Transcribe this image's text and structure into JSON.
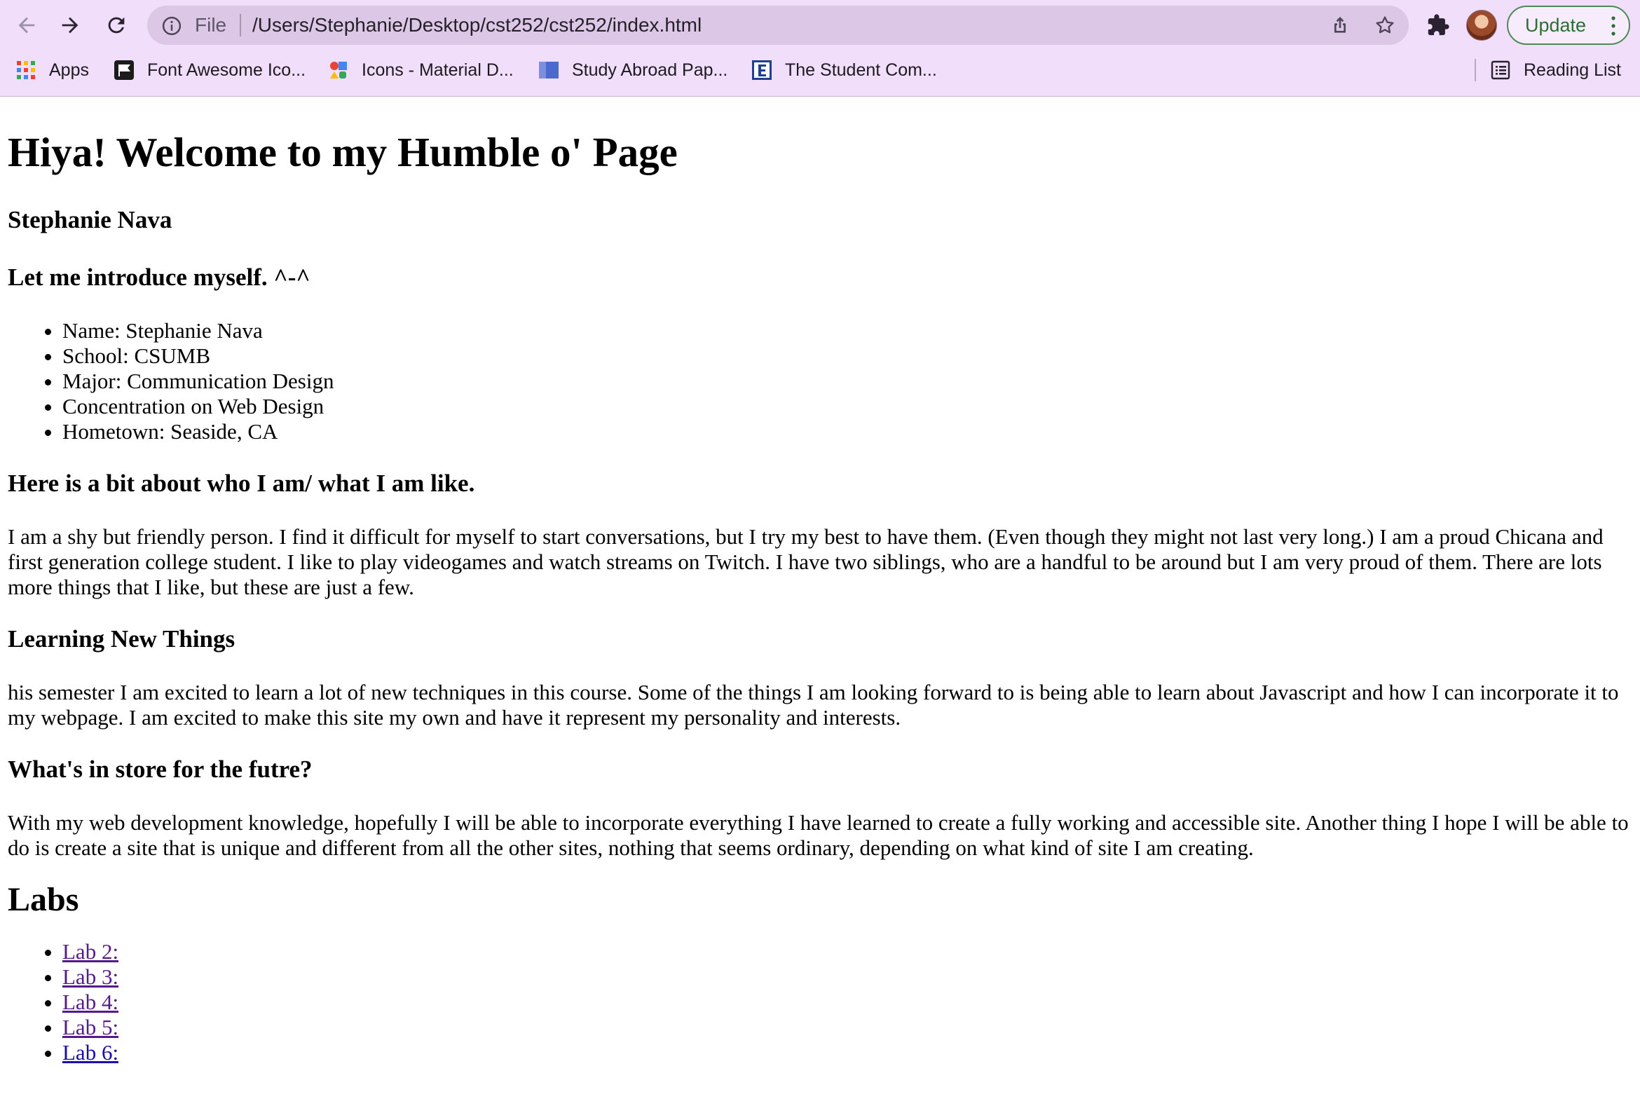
{
  "browser": {
    "scheme_label": "File",
    "url": "/Users/Stephanie/Desktop/cst252/cst252/index.html",
    "update_label": "Update",
    "icons": [
      "back-icon",
      "forward-icon",
      "reload-icon",
      "info-icon",
      "share-icon",
      "star-icon",
      "puzzle-icon",
      "kebab-icon"
    ],
    "accent": "#2c6e36",
    "theme_background": "#f0defa"
  },
  "bookmarks": {
    "items": [
      {
        "label": "Apps"
      },
      {
        "label": "Font Awesome Ico..."
      },
      {
        "label": "Icons - Material D..."
      },
      {
        "label": "Study Abroad Pap..."
      },
      {
        "label": "The Student Com..."
      }
    ],
    "reading_list": "Reading List"
  },
  "page": {
    "title": "Hiya! Welcome to my Humble o' Page",
    "author": "Stephanie Nava",
    "intro_heading": "Let me introduce myself. ^-^",
    "intro_items": [
      "Name: Stephanie Nava",
      "School: CSUMB",
      "Major: Communication Design",
      "Concentration on Web Design",
      "Hometown: Seaside, CA"
    ],
    "about_heading": "Here is a bit about who I am/ what I am like.",
    "about_text": "I am a shy but friendly person. I find it difficult for myself to start conversations, but I try my best to have them. (Even though they might not last very long.) I am a proud Chicana and first generation college student. I like to play videogames and watch streams on Twitch. I have two siblings, who are a handful to be around but I am very proud of them. There are lots more things that I like, but these are just a few.",
    "learning_heading": "Learning New Things",
    "learning_text": "his semester I am excited to learn a lot of new techniques in this course. Some of the things I am looking forward to is being able to learn about Javascript and how I can incorporate it to my webpage. I am excited to make this site my own and have it represent my personality and interests.",
    "future_heading": "What's in store for the futre?",
    "future_text": "With my web development knowledge, hopefully I will be able to incorporate everything I have learned to create a fully working and accessible site. Another thing I hope I will be able to do is create a site that is unique and different from all the other sites, nothing that seems ordinary, depending on what kind of site I am creating.",
    "labs_heading": "Labs",
    "labs": [
      {
        "label": "Lab 2:",
        "visited": true
      },
      {
        "label": "Lab 3:",
        "visited": true
      },
      {
        "label": "Lab 4:",
        "visited": true
      },
      {
        "label": "Lab 5:",
        "visited": true
      },
      {
        "label": "Lab 6:",
        "visited": false
      }
    ],
    "link_color": "#1a0dab",
    "visited_link_color": "#551a8b"
  }
}
